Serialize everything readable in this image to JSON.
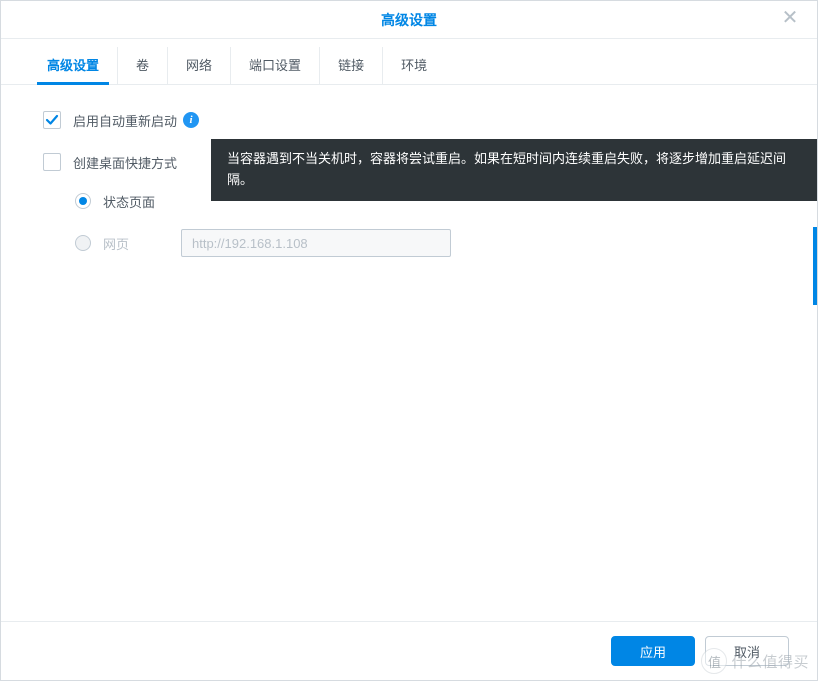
{
  "dialog": {
    "title": "高级设置"
  },
  "tabs": {
    "t0": "高级设置",
    "t1": "卷",
    "t2": "网络",
    "t3": "端口设置",
    "t4": "链接",
    "t5": "环境"
  },
  "settings": {
    "auto_restart_label": "启用自动重新启动",
    "create_shortcut_label": "创建桌面快捷方式",
    "radio_status_label": "状态页面",
    "radio_web_label": "网页",
    "web_url_value": "http://192.168.1.108"
  },
  "tooltip": {
    "text": "当容器遇到不当关机时，容器将尝试重启。如果在短时间内连续重启失败，将逐步增加重启延迟间隔。"
  },
  "footer": {
    "apply": "应用",
    "cancel": "取消"
  },
  "watermark": {
    "badge": "值",
    "text": "什么值得买"
  },
  "icons": {
    "info": "i"
  }
}
